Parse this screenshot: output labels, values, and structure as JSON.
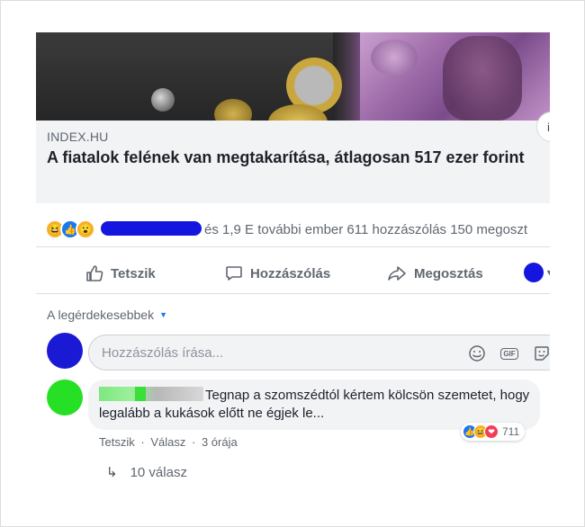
{
  "link": {
    "domain": "INDEX.HU",
    "headline": "A fiatalok felének van megtakarítása, átlagosan 517 ezer forint",
    "info_icon": "i"
  },
  "summary": {
    "reactions": [
      "haha",
      "like",
      "wow"
    ],
    "text": "és 1,9 E további ember  611 hozzászólás  150 megoszt"
  },
  "actions": {
    "like": "Tetszik",
    "comment": "Hozzászólás",
    "share": "Megosztás"
  },
  "sort": {
    "label": "A legérdekesebbek"
  },
  "composer": {
    "placeholder": "Hozzászólás írása..."
  },
  "comment": {
    "text": "Tegnap a szomszédtól kértem kölcsön szemetet, hogy legalább a kukások előtt ne égjek le...",
    "reactions": [
      "like",
      "haha",
      "love"
    ],
    "reaction_count": "711",
    "like_label": "Tetszik",
    "reply_label": "Válasz",
    "time": "3 órája",
    "replies_label": "10 válasz"
  },
  "colors": {
    "redaction_blue": "#1515e0",
    "redaction_green": "#25e025",
    "link_meta_bg": "#f2f3f5",
    "secondary_text": "#606770"
  }
}
